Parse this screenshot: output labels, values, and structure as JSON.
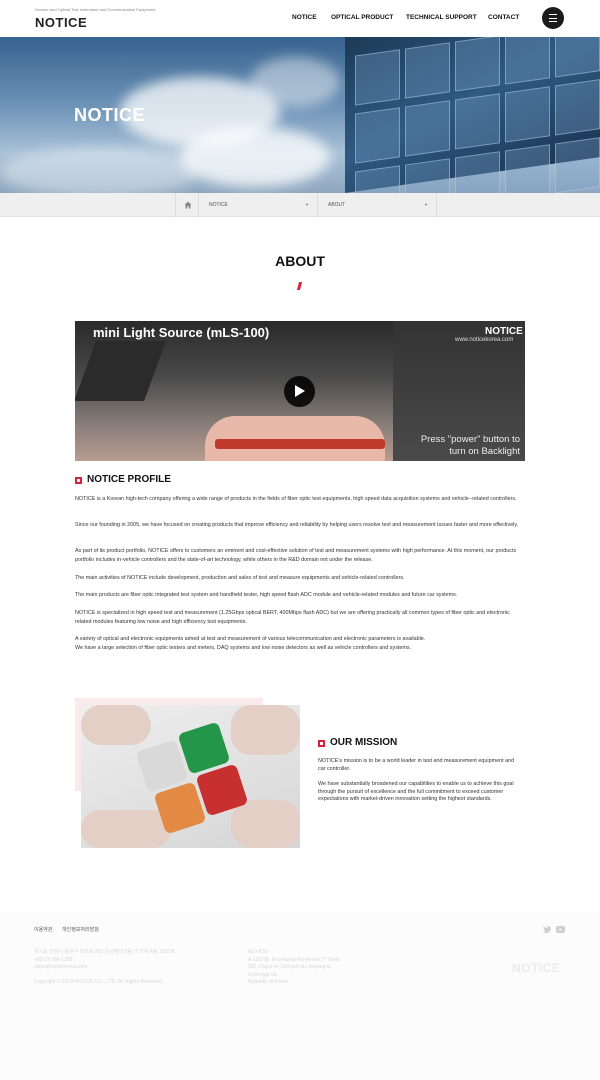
{
  "header": {
    "tagline": "Nuclear and Optical Test Instrument and Communication Equipment",
    "logo": "NOTICE",
    "nav": [
      "NOTICE",
      "OPTICAL PRODUCT",
      "TECHNICAL SUPPORT",
      "CONTACT"
    ]
  },
  "hero": {
    "title": "NOTICE"
  },
  "breadcrumb": {
    "level1": "NOTICE",
    "level2": "ABOUT"
  },
  "about": {
    "title": "ABOUT"
  },
  "video": {
    "title": "mini Light Source (mLS-100)",
    "brand": "NOTICE",
    "url": "www.noticekorea.com",
    "caption_line1": "Press \"power\" button to",
    "caption_line2": "turn on Backlight"
  },
  "profile": {
    "heading": "NOTICE PROFILE",
    "paragraphs": [
      "NOTICE is a Korean high-tech company offering a wide range of products in the fields of fiber optic test equipments, high speed data acquisition systems and vehicle--related controllers.",
      "Since our founding in 2005, we have focused on creating products that improve efficiency and reliability by helping users resolve test and measurement issues faster and more effectively.",
      "As part of its product portfolio, NOTICE offers to customers an eminent and cost-effective solution of test and measurement systems with high performance. At this moment, our products portfolio includes in-vehicle controllers and the state-of-art technology, while others in the R&D domain not under the release.",
      "The main activities of NOTICE include development, production and sales of test and measure equipments and vehicle-related controllers.",
      "The main products are fiber optic integrated test system and handheld tester, high speed flash ADC module and vehicle-related modules and future car systems.",
      "NOTICE is specialized in high speed test and measurement (1.25Gbps optical BERT, 400Mbps flash ADC) but we are offering practically all common types of fiber optic and electronic related modules featuring low noise and high efficiency test equipments.",
      "A variety of optical and electronic equipments aimed at test and measurement of various telecommunication and electronic parameters is available.",
      "We have a large selection of fiber optic testers and meters, DAQ systems and low noise detectors as well as vehicle controllers and systems."
    ]
  },
  "mission": {
    "heading": "OUR MISSION",
    "paragraphs": [
      "NOTICE's mission is to be a world leader in test and measurement equipment and car controller.",
      "We have substantially broadened our capabilities to enable us to achieve this goal through the pursuit of excellence and the full commitment to exceed customer expectations with market-driven innovation setting the highest standards."
    ]
  },
  "footer": {
    "links": [
      "이용약관",
      "개인정보처리방침"
    ],
    "kr_lines": [
      "경기도 안양시 동안구 학의로 282 금강펜테리움 IT 타워 A동 1307호",
      "+82-31-384-1289",
      "sales@noticekorea.com"
    ],
    "copyright": "Copyright © 2019 NOTICE CO., LTD. All Rights Reserved.",
    "en_lines": [
      "A1b-B1b",
      "A-1307/B, Keumkang Penterium IT Tower,",
      "282, Hagui-ro, Dongan-gu, Anyang-si,",
      "Gyeonggi-do,",
      "Republic of Korea"
    ],
    "logo": "NOTICE"
  }
}
